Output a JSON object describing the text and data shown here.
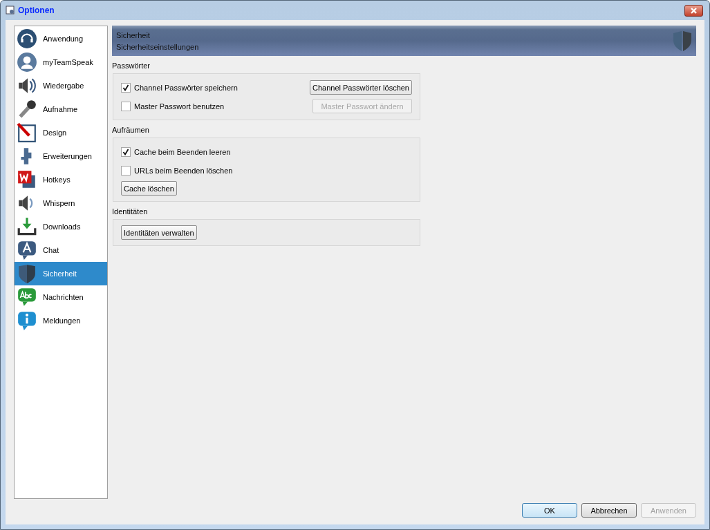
{
  "window": {
    "title": "Optionen"
  },
  "sidebar": {
    "items": [
      {
        "label": "Anwendung",
        "selected": false
      },
      {
        "label": "myTeamSpeak",
        "selected": false
      },
      {
        "label": "Wiedergabe",
        "selected": false
      },
      {
        "label": "Aufnahme",
        "selected": false
      },
      {
        "label": "Design",
        "selected": false
      },
      {
        "label": "Erweiterungen",
        "selected": false
      },
      {
        "label": "Hotkeys",
        "selected": false
      },
      {
        "label": "Whispern",
        "selected": false
      },
      {
        "label": "Downloads",
        "selected": false
      },
      {
        "label": "Chat",
        "selected": false
      },
      {
        "label": "Sicherheit",
        "selected": true
      },
      {
        "label": "Nachrichten",
        "selected": false
      },
      {
        "label": "Meldungen",
        "selected": false
      }
    ]
  },
  "header": {
    "title": "Sicherheit",
    "subtitle": "Sicherheitseinstellungen"
  },
  "sections": [
    {
      "title": "Passwörter",
      "rows": [
        {
          "checkbox": {
            "label": "Channel Passwörter speichern",
            "checked": true
          },
          "button": {
            "label": "Channel Passwörter löschen",
            "disabled": false
          }
        },
        {
          "checkbox": {
            "label": "Master Passwort benutzen",
            "checked": false
          },
          "button": {
            "label": "Master Passwort ändern",
            "disabled": true
          }
        }
      ]
    },
    {
      "title": "Aufräumen",
      "rows": [
        {
          "checkbox": {
            "label": "Cache beim Beenden leeren",
            "checked": true
          }
        },
        {
          "checkbox": {
            "label": "URLs beim Beenden löschen",
            "checked": false
          }
        },
        {
          "button": {
            "label": "Cache löschen",
            "disabled": false
          }
        }
      ]
    },
    {
      "title": "Identitäten",
      "rows": [
        {
          "button": {
            "label": "Identitäten verwalten",
            "disabled": false
          }
        }
      ]
    }
  ],
  "buttons": [
    {
      "label": "OK",
      "disabled": false,
      "default": true
    },
    {
      "label": "Abbrechen",
      "disabled": false,
      "default": false
    },
    {
      "label": "Anwenden",
      "disabled": true,
      "default": false
    }
  ]
}
